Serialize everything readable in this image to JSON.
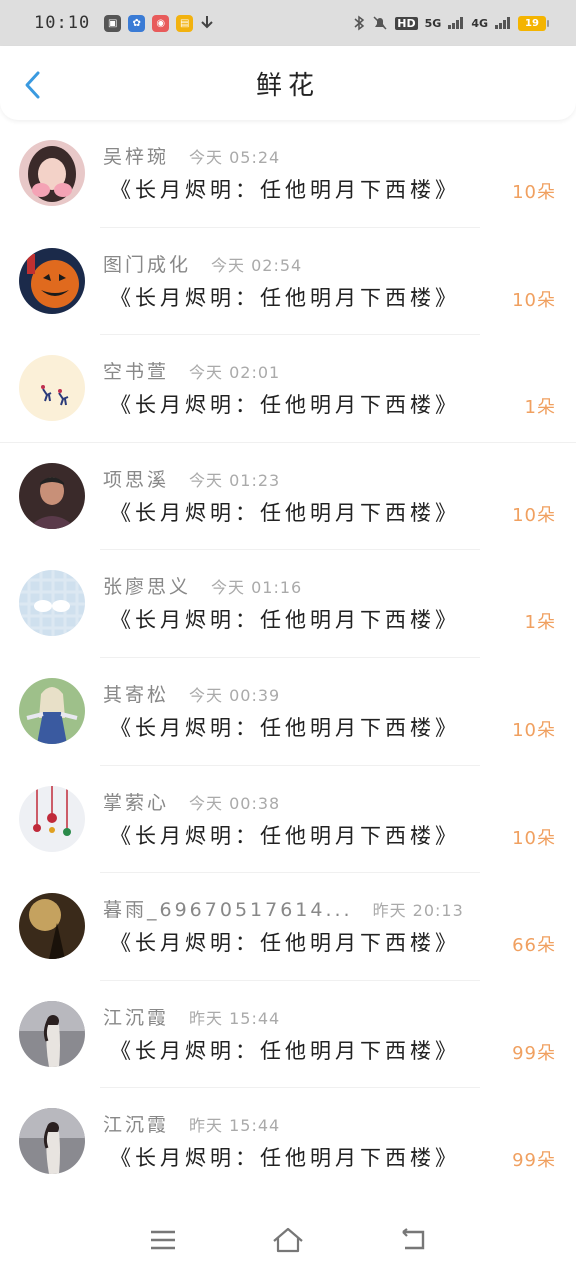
{
  "status_bar": {
    "time": "10:10",
    "apps": [
      {
        "icon": "video-app-icon",
        "color": "#555555",
        "label": "▣"
      },
      {
        "icon": "clover-app-icon",
        "color": "#3a7bd5",
        "label": "✿"
      },
      {
        "icon": "red-app-icon",
        "color": "#e85b5b",
        "label": "◉"
      },
      {
        "icon": "yellow-app-icon",
        "color": "#f2b20f",
        "label": "▤"
      }
    ],
    "hd_label": "HD",
    "net_5g": "5G",
    "net_4g": "4G",
    "battery": "19"
  },
  "header": {
    "title": "鲜花",
    "back_color": "#3a9ae0"
  },
  "rows": [
    {
      "user": "吴梓琬",
      "time": "今天 05:24",
      "book": "《长月烬明：任他明月下西楼》",
      "count": "10朵",
      "avatar": "girl-pink"
    },
    {
      "user": "图门成化",
      "time": "今天 02:54",
      "book": "《长月烬明：任他明月下西楼》",
      "count": "10朵",
      "avatar": "pumpkin"
    },
    {
      "user": "空书萱",
      "time": "今天 02:01",
      "book": "《长月烬明：任他明月下西楼》",
      "count": "1朵",
      "avatar": "deer"
    },
    {
      "user": "项思溪",
      "time": "今天 01:23",
      "book": "《长月烬明：任他明月下西楼》",
      "count": "10朵",
      "avatar": "man"
    },
    {
      "user": "张廖思义",
      "time": "今天 01:16",
      "book": "《长月烬明：任他明月下西楼》",
      "count": "1朵",
      "avatar": "clouds"
    },
    {
      "user": "其寄松",
      "time": "今天 00:39",
      "book": "《长月烬明：任他明月下西楼》",
      "count": "10朵",
      "avatar": "anime"
    },
    {
      "user": "掌萦心",
      "time": "今天 00:38",
      "book": "《长月烬明：任他明月下西楼》",
      "count": "10朵",
      "avatar": "ornaments"
    },
    {
      "user": "暮雨_69670517614...",
      "time": "昨天 20:13",
      "book": "《长月烬明：任他明月下西楼》",
      "count": "66朵",
      "avatar": "sunset"
    },
    {
      "user": "江沉霞",
      "time": "昨天 15:44",
      "book": "《长月烬明：任他明月下西楼》",
      "count": "99朵",
      "avatar": "lady"
    },
    {
      "user": "江沉霞",
      "time": "昨天 15:44",
      "book": "《长月烬明：任他明月下西楼》",
      "count": "99朵",
      "avatar": "lady"
    }
  ],
  "navbar": {
    "menu_icon": "menu-icon",
    "home_icon": "home-icon",
    "back_icon": "return-icon"
  }
}
